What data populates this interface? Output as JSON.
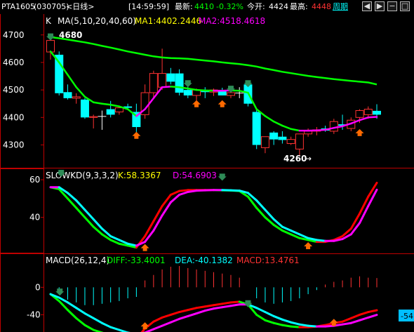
{
  "header": {
    "symbol": "PTA1605",
    "code": "(030705)",
    "period": "<日线>",
    "time": "[14:59:59]",
    "latest_label": "最新:",
    "latest_value": "4410",
    "change_pct": "-0.32%",
    "open_label": "今开:",
    "open_value": "4424",
    "high_label": "最高:",
    "high_value": "4448",
    "period_link": "周期",
    "colors": {
      "up": "#ff3232",
      "down": "#00ffff",
      "green": "#00ff00",
      "white": "#ffffff",
      "yellow": "#ffff00",
      "frame": "#c00000"
    }
  },
  "window_buttons": [
    {
      "name": "left-arrow-button",
      "symbol": "◀"
    },
    {
      "name": "right-arrow-button",
      "symbol": "▶"
    },
    {
      "name": "minus-button",
      "symbol": "−"
    },
    {
      "name": "square-button",
      "symbol": "□"
    }
  ],
  "price_panel": {
    "k_label": "K",
    "ma_params": "MA(5,10,20,40,60)",
    "ma1": "MA1:4402.2446",
    "ma2": "MA2:4518.4618",
    "y_ticks": [
      "4700",
      "4600",
      "4500",
      "4400",
      "4300"
    ],
    "high_marker": "4680",
    "low_marker": "4260"
  },
  "kd_panel": {
    "params": "SLOWKD(9,3,3,2)",
    "k": "K:58.3367",
    "d": "D:54.6903",
    "y_ticks": [
      "60",
      "40"
    ]
  },
  "macd_panel": {
    "params": "MACD(26,12,4)",
    "diff": "DIFF:-33.4001",
    "dea": "DEA:-40.1382",
    "macd": "MACD:13.4761",
    "y_ticks": [
      "0",
      "-40"
    ],
    "badge": "-54"
  },
  "chart_data": {
    "type": "candlestick",
    "ylim_price": [
      4240,
      4730
    ],
    "candles": [
      {
        "o": 4638,
        "h": 4680,
        "l": 4610,
        "c": 4680
      },
      {
        "o": 4628,
        "h": 4640,
        "l": 4480,
        "c": 4488
      },
      {
        "o": 4492,
        "h": 4520,
        "l": 4465,
        "c": 4470
      },
      {
        "o": 4470,
        "h": 4488,
        "l": 4450,
        "c": 4475
      },
      {
        "o": 4465,
        "h": 4470,
        "l": 4395,
        "c": 4400
      },
      {
        "o": 4400,
        "h": 4410,
        "l": 4360,
        "c": 4403
      },
      {
        "o": 4405,
        "h": 4425,
        "l": 4355,
        "c": 4405
      },
      {
        "o": 4430,
        "h": 4460,
        "l": 4400,
        "c": 4410
      },
      {
        "o": 4420,
        "h": 4440,
        "l": 4410,
        "c": 4435
      },
      {
        "o": 4440,
        "h": 4450,
        "l": 4430,
        "c": 4435
      },
      {
        "o": 4420,
        "h": 4450,
        "l": 4340,
        "c": 4365
      },
      {
        "o": 4410,
        "h": 4520,
        "l": 4395,
        "c": 4490
      },
      {
        "o": 4490,
        "h": 4570,
        "l": 4470,
        "c": 4560
      },
      {
        "o": 4510,
        "h": 4650,
        "l": 4500,
        "c": 4560
      },
      {
        "o": 4560,
        "h": 4580,
        "l": 4520,
        "c": 4530
      },
      {
        "o": 4560,
        "h": 4575,
        "l": 4480,
        "c": 4490
      },
      {
        "o": 4500,
        "h": 4530,
        "l": 4470,
        "c": 4480
      },
      {
        "o": 4480,
        "h": 4505,
        "l": 4460,
        "c": 4500
      },
      {
        "o": 4500,
        "h": 4510,
        "l": 4470,
        "c": 4492
      },
      {
        "o": 4492,
        "h": 4505,
        "l": 4478,
        "c": 4500
      },
      {
        "o": 4500,
        "h": 4508,
        "l": 4480,
        "c": 4480
      },
      {
        "o": 4480,
        "h": 4500,
        "l": 4470,
        "c": 4490
      },
      {
        "o": 4490,
        "h": 4510,
        "l": 4470,
        "c": 4490
      },
      {
        "o": 4520,
        "h": 4530,
        "l": 4440,
        "c": 4450
      },
      {
        "o": 4420,
        "h": 4430,
        "l": 4285,
        "c": 4300
      },
      {
        "o": 4290,
        "h": 4330,
        "l": 4270,
        "c": 4330
      },
      {
        "o": 4345,
        "h": 4350,
        "l": 4300,
        "c": 4320
      },
      {
        "o": 4330,
        "h": 4350,
        "l": 4305,
        "c": 4318
      },
      {
        "o": 4305,
        "h": 4330,
        "l": 4300,
        "c": 4320
      },
      {
        "o": 4285,
        "h": 4340,
        "l": 4260,
        "c": 4340
      },
      {
        "o": 4340,
        "h": 4360,
        "l": 4330,
        "c": 4350
      },
      {
        "o": 4350,
        "h": 4365,
        "l": 4335,
        "c": 4355
      },
      {
        "o": 4360,
        "h": 4370,
        "l": 4348,
        "c": 4352
      },
      {
        "o": 4350,
        "h": 4395,
        "l": 4340,
        "c": 4385
      },
      {
        "o": 4375,
        "h": 4410,
        "l": 4355,
        "c": 4370
      },
      {
        "o": 4360,
        "h": 4400,
        "l": 4350,
        "c": 4390
      },
      {
        "o": 4400,
        "h": 4430,
        "l": 4380,
        "c": 4425
      },
      {
        "o": 4410,
        "h": 4440,
        "l": 4395,
        "c": 4430
      },
      {
        "o": 4424,
        "h": 4448,
        "l": 4395,
        "c": 4410
      }
    ],
    "ma_long": [
      4692,
      4688,
      4683,
      4678,
      4673,
      4667,
      4660,
      4654,
      4647,
      4640,
      4634,
      4628,
      4622,
      4618,
      4616,
      4615,
      4613,
      4610,
      4607,
      4604,
      4600,
      4597,
      4594,
      4590,
      4585,
      4578,
      4572,
      4566,
      4561,
      4556,
      4551,
      4547,
      4543,
      4539,
      4536,
      4533,
      4530,
      4527,
      4520
    ],
    "ma_short": [
      4640,
      4600,
      4555,
      4510,
      4475,
      4455,
      4450,
      4446,
      4440,
      4430,
      4405,
      4430,
      4470,
      4510,
      4512,
      4510,
      4505,
      4500,
      4498,
      4497,
      4497,
      4498,
      4497,
      4490,
      4430,
      4405,
      4385,
      4370,
      4358,
      4352,
      4352,
      4353,
      4355,
      4362,
      4368,
      4378,
      4390,
      4400,
      4402
    ],
    "kd_k": [
      56,
      55,
      50,
      45,
      40,
      35,
      31,
      28,
      26,
      25,
      24,
      30,
      38,
      46,
      52,
      54,
      54.5,
      54.5,
      54.5,
      54.5,
      54.4,
      54.3,
      54,
      51,
      45,
      40,
      36,
      33,
      31,
      29,
      28,
      27,
      27,
      28,
      30,
      34,
      42,
      51,
      58.34
    ],
    "kd_d": [
      56,
      56,
      53,
      49,
      44,
      39,
      34,
      30,
      28,
      26,
      25,
      27,
      33,
      41,
      48,
      52,
      53.5,
      54.2,
      54.4,
      54.5,
      54.5,
      54.4,
      54.2,
      53,
      49,
      44,
      39,
      35,
      33,
      31,
      29,
      28,
      27.5,
      27.5,
      28.5,
      31,
      37,
      46,
      54.69
    ],
    "kd_ylim": [
      22,
      63
    ],
    "macd_diff": [
      -10,
      -20,
      -33,
      -45,
      -55,
      -62,
      -66,
      -70,
      -72,
      -70,
      -75,
      -60,
      -50,
      -44,
      -40,
      -36,
      -33,
      -30,
      -28,
      -26,
      -24,
      -22,
      -21,
      -25,
      -40,
      -48,
      -52,
      -55,
      -57,
      -58,
      -58,
      -57,
      -55,
      -52,
      -50,
      -45,
      -40,
      -36,
      -33.4
    ],
    "macd_dea": [
      -10,
      -15,
      -22,
      -30,
      -38,
      -45,
      -52,
      -58,
      -62,
      -66,
      -68,
      -66,
      -61,
      -56,
      -51,
      -46,
      -42,
      -38,
      -34,
      -31,
      -29,
      -27,
      -25,
      -25,
      -30,
      -36,
      -42,
      -47,
      -51,
      -54,
      -56,
      -57,
      -57,
      -56,
      -54,
      -52,
      -48,
      -44,
      -40.14
    ],
    "macd_hist": [
      0,
      -8,
      -18,
      -22,
      -26,
      -26,
      -24,
      -22,
      -20,
      -16,
      -14,
      10,
      18,
      26,
      30,
      31,
      28,
      26,
      24,
      22,
      20,
      18,
      14,
      0,
      -16,
      -22,
      -24,
      -22,
      -20,
      -16,
      -10,
      -4,
      4,
      8,
      10,
      14,
      16,
      14,
      13.48
    ],
    "macd_ylim": [
      -62,
      32
    ]
  }
}
